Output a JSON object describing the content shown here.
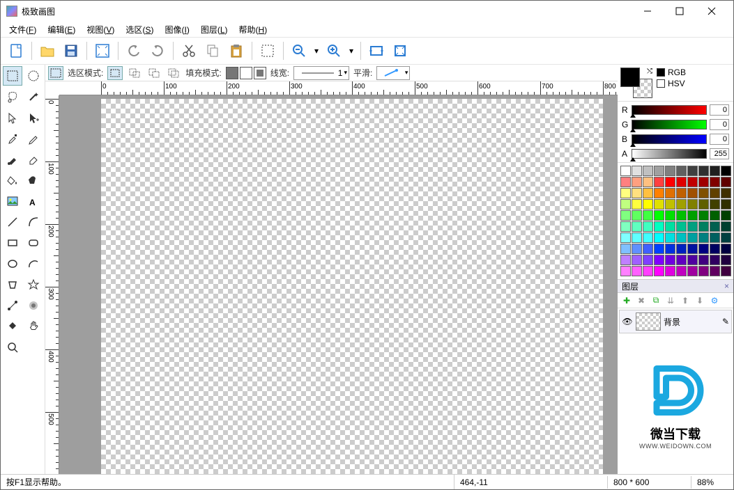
{
  "title": "极致画图",
  "menus": [
    {
      "label": "文件",
      "key": "F"
    },
    {
      "label": "编辑",
      "key": "E"
    },
    {
      "label": "视图",
      "key": "V"
    },
    {
      "label": "选区",
      "key": "S"
    },
    {
      "label": "图像",
      "key": "I"
    },
    {
      "label": "图层",
      "key": "L"
    },
    {
      "label": "帮助",
      "key": "H"
    }
  ],
  "optbar": {
    "sel_mode_label": "选区模式:",
    "fill_mode_label": "填充模式:",
    "line_width_label": "线宽:",
    "line_width_value": "1",
    "smooth_label": "平滑:"
  },
  "color": {
    "mode_rgb": "RGB",
    "mode_hsv": "HSV",
    "r_label": "R",
    "r_value": "0",
    "g_label": "G",
    "g_value": "0",
    "b_label": "B",
    "b_value": "0",
    "a_label": "A",
    "a_value": "255"
  },
  "palette": [
    "#ffffff",
    "#e0e0e0",
    "#c0c0c0",
    "#a0a0a0",
    "#808080",
    "#606060",
    "#404040",
    "#303030",
    "#202020",
    "#000000",
    "#ff8080",
    "#ffa080",
    "#ffc080",
    "#ff4040",
    "#ff0000",
    "#e00000",
    "#c00000",
    "#a00000",
    "#800000",
    "#600000",
    "#ffff80",
    "#ffe080",
    "#ffc040",
    "#ff8000",
    "#e07000",
    "#c06000",
    "#a05000",
    "#805000",
    "#604000",
    "#403000",
    "#c0ff80",
    "#ffff40",
    "#ffff00",
    "#e0e000",
    "#c0c000",
    "#a0a000",
    "#808000",
    "#606000",
    "#404000",
    "#303000",
    "#80ff80",
    "#60ff60",
    "#40ff40",
    "#00ff00",
    "#00e000",
    "#00c000",
    "#00a000",
    "#008000",
    "#006000",
    "#004000",
    "#80ffc0",
    "#60ffc0",
    "#40ffc0",
    "#00ffc0",
    "#00e0a0",
    "#00c090",
    "#00a080",
    "#008060",
    "#006050",
    "#004030",
    "#80ffff",
    "#60ffff",
    "#40ffff",
    "#00ffff",
    "#00e0e0",
    "#00c0c0",
    "#00a0a0",
    "#008080",
    "#006060",
    "#004040",
    "#80c0ff",
    "#6090ff",
    "#4060ff",
    "#0040ff",
    "#0030e0",
    "#0020c0",
    "#0010a0",
    "#000080",
    "#000060",
    "#000040",
    "#c080ff",
    "#a060ff",
    "#8040ff",
    "#8000ff",
    "#7000e0",
    "#6000c0",
    "#5000a0",
    "#400080",
    "#300060",
    "#200040",
    "#ff80ff",
    "#ff60ff",
    "#ff40ff",
    "#ff00ff",
    "#e000e0",
    "#c000c0",
    "#a000a0",
    "#800080",
    "#600060",
    "#400040"
  ],
  "layers": {
    "panel_title": "图层",
    "items": [
      {
        "name": "背景",
        "visible": true
      }
    ]
  },
  "logo": {
    "text": "微当下载",
    "url": "WWW.WEIDOWN.COM"
  },
  "status": {
    "help": "按F1显示帮助。",
    "coords": "464,-11",
    "dim": "800 * 600",
    "zoom": "88%"
  },
  "ruler": {
    "h_ticks": [
      0,
      100,
      200,
      300,
      400,
      500,
      600,
      700,
      800
    ],
    "v_ticks": [
      0,
      100,
      200,
      300,
      400,
      500
    ]
  }
}
